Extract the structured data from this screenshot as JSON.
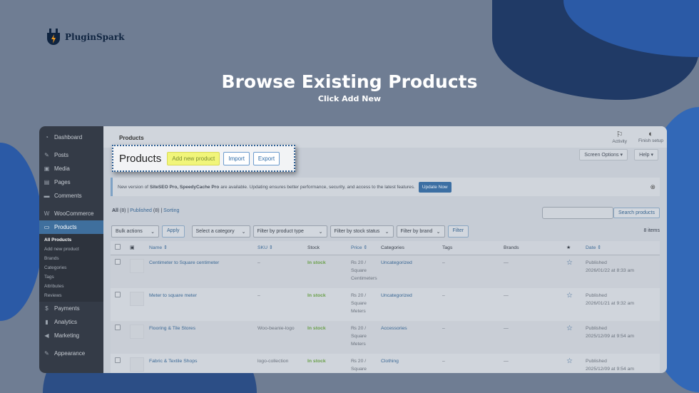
{
  "brand": {
    "name": "PluginSpark"
  },
  "heading": {
    "title": "Browse Existing Products",
    "subtitle": "Click Add New"
  },
  "sidebar": {
    "items": [
      {
        "label": "Dashboard",
        "icon": "dashboard-icon",
        "glyph": "◔"
      },
      {
        "label": "Posts",
        "icon": "pin-icon",
        "glyph": "✎"
      },
      {
        "label": "Media",
        "icon": "media-icon",
        "glyph": "▣"
      },
      {
        "label": "Pages",
        "icon": "pages-icon",
        "glyph": "▤"
      },
      {
        "label": "Comments",
        "icon": "comments-icon",
        "glyph": "▬"
      },
      {
        "label": "WooCommerce",
        "icon": "woocommerce-icon",
        "glyph": "W"
      },
      {
        "label": "Products",
        "icon": "products-icon",
        "glyph": "▭"
      }
    ],
    "submenu": [
      "All Products",
      "Add new product",
      "Brands",
      "Categories",
      "Tags",
      "Attributes",
      "Reviews"
    ],
    "items2": [
      {
        "label": "Payments",
        "icon": "payments-icon",
        "glyph": "$"
      },
      {
        "label": "Analytics",
        "icon": "analytics-icon",
        "glyph": "▮"
      },
      {
        "label": "Marketing",
        "icon": "marketing-icon",
        "glyph": "◀"
      },
      {
        "label": "Appearance",
        "icon": "appearance-icon",
        "glyph": "✎"
      }
    ]
  },
  "topbar": {
    "breadcrumb": "Products",
    "activity": "Activity",
    "finish_setup": "Finish setup"
  },
  "header": {
    "title": "Products",
    "add_new": "Add new product",
    "import": "Import",
    "export": "Export",
    "screen_options": "Screen Options ▾",
    "help": "Help ▾"
  },
  "notice": {
    "pre": "New version of",
    "plugins": "SiteSEO Pro, SpeedyCache Pro",
    "post": "are available. Updating ensures better performance, security, and access to the latest features.",
    "button": "Update Now"
  },
  "filters": {
    "all": "All",
    "all_count": "(8)",
    "published": "Published",
    "published_count": "(8)",
    "sorting": "Sorting",
    "search_button": "Search products",
    "search_placeholder": "",
    "bulk_actions": "Bulk actions",
    "apply": "Apply",
    "category": "Select a category",
    "product_type": "Filter by product type",
    "stock_status": "Filter by stock status",
    "brand": "Filter by brand",
    "filter": "Filter",
    "items_count": "8 items"
  },
  "table": {
    "headers": {
      "name": "Name",
      "sku": "SKU",
      "stock": "Stock",
      "price": "Price",
      "categories": "Categories",
      "tags": "Tags",
      "brands": "Brands",
      "date": "Date"
    },
    "rows": [
      {
        "name": "Centimeter to Square centimeter",
        "sku": "–",
        "stock": "In stock",
        "price": "₨ 20 / Square Centimeters",
        "category": "Uncategorized",
        "tags": "–",
        "brands": "—",
        "status": "Published",
        "date": "2026/01/22 at 8:33 am"
      },
      {
        "name": "Meter to square meter",
        "sku": "–",
        "stock": "In stock",
        "price": "₨ 20 / Square Meters",
        "category": "Uncategorized",
        "tags": "–",
        "brands": "—",
        "status": "Published",
        "date": "2026/01/21 at 9:32 am"
      },
      {
        "name": "Flooring & Tile Stores",
        "sku": "Woo-beanie-logo",
        "stock": "In stock",
        "price": "₨ 20 / Square Meters",
        "category": "Accessories",
        "tags": "–",
        "brands": "—",
        "status": "Published",
        "date": "2025/12/09 at 9:54 am"
      },
      {
        "name": "Fabric & Textile Shops",
        "sku": "logo-collection",
        "stock": "In stock",
        "price": "₨ 20 / Square",
        "category": "Clothing",
        "tags": "–",
        "brands": "—",
        "status": "Published",
        "date": "2025/12/09 at 9:54 am"
      }
    ]
  },
  "colors": {
    "background": "#6f7d93",
    "accent": "#3c6fa3",
    "highlight": "#f1f57a",
    "in_stock": "#6aa04a"
  }
}
